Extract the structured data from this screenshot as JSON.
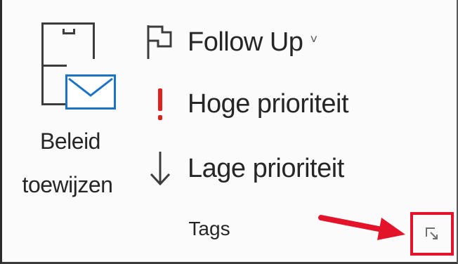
{
  "ribbon_group": {
    "name": "Tags",
    "assign_policy": {
      "line1": "Beleid",
      "line2": "toewijzen",
      "icon": "assign-policy-icon"
    },
    "follow_up": {
      "label": "Follow Up",
      "chevron": "˅",
      "icon": "flag-icon"
    },
    "high_importance": {
      "label": "Hoge prioriteit",
      "icon": "high-importance-icon"
    },
    "low_importance": {
      "label": "Lage prioriteit",
      "icon": "low-importance-arrow-icon"
    },
    "dialog_launcher": {
      "icon": "dialog-launcher-icon"
    }
  },
  "annotation": {
    "arrow_icon": "red-arrow-icon",
    "highlight_color": "#e3132a"
  },
  "colors": {
    "envelope_blue": "#1a73c7",
    "importance_red": "#e0201c",
    "text": "#262626"
  }
}
